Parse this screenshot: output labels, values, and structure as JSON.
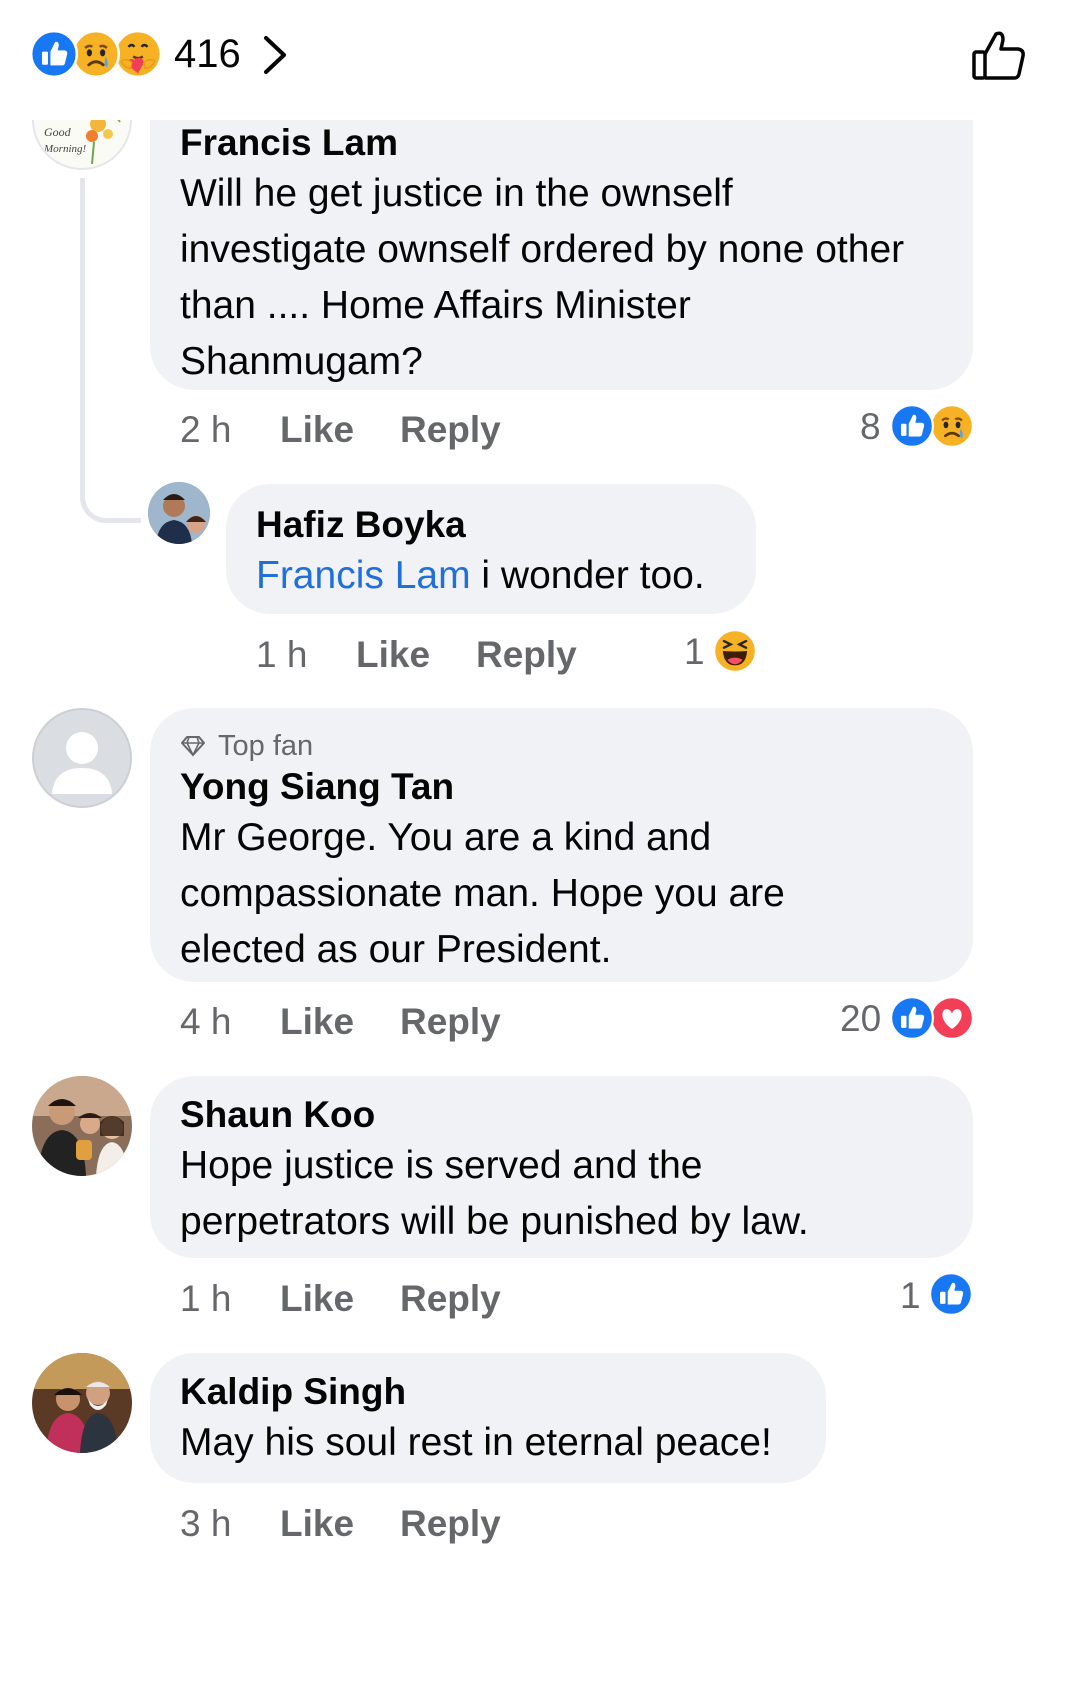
{
  "header": {
    "reaction_count": "416",
    "reaction_icons": [
      "like-icon",
      "sad-icon",
      "care-icon"
    ],
    "like_button_icon": "thumbs-up-outline-icon"
  },
  "colors": {
    "accent": "#1877f2",
    "bubble": "#f0f2f5",
    "meta": "#65676b",
    "mention": "#216fdb",
    "love": "#f33e58",
    "emoji": "#f7b125"
  },
  "comments": [
    {
      "author": "Francis Lam",
      "avatar_text": [
        "Good",
        "Morning!"
      ],
      "lines": [
        "Will he get justice in the ownself",
        "investigate ownself ordered by none other",
        "than .... Home Affairs Minister",
        "Shanmugam?"
      ],
      "time": "2 h",
      "like_label": "Like",
      "reply_label": "Reply",
      "reactions": {
        "count": "8",
        "icons": [
          "like-icon",
          "sad-icon"
        ]
      }
    },
    {
      "author": "Hafiz Boyka",
      "mention": "Francis Lam",
      "text": " i wonder too.",
      "time": "1 h",
      "like_label": "Like",
      "reply_label": "Reply",
      "reactions": {
        "count": "1",
        "icons": [
          "haha-icon"
        ]
      }
    },
    {
      "badge": "Top fan",
      "author": "Yong Siang Tan",
      "lines": [
        "Mr George. You are a kind and",
        "compassionate man. Hope you are",
        "elected as our President."
      ],
      "time": "4 h",
      "like_label": "Like",
      "reply_label": "Reply",
      "reactions": {
        "count": "20",
        "icons": [
          "like-icon",
          "love-icon"
        ]
      }
    },
    {
      "author": "Shaun Koo",
      "lines": [
        "Hope justice is served and the",
        "perpetrators will be punished by law."
      ],
      "time": "1 h",
      "like_label": "Like",
      "reply_label": "Reply",
      "reactions": {
        "count": "1",
        "icons": [
          "like-icon"
        ]
      }
    },
    {
      "author": "Kaldip Singh",
      "text": "May his soul rest in eternal peace!",
      "time": "3 h",
      "like_label": "Like",
      "reply_label": "Reply"
    }
  ]
}
